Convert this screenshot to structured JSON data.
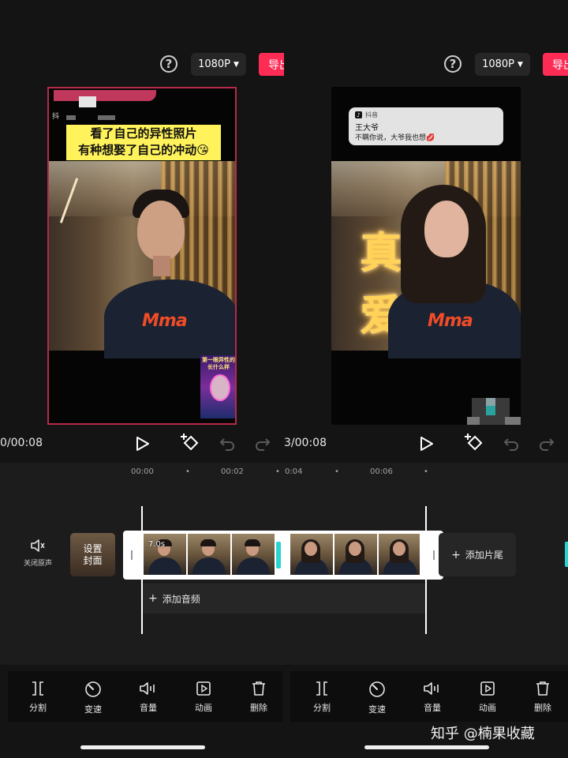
{
  "top_bar": {
    "help_symbol": "?",
    "resolution": "1080P",
    "export_label": "导出"
  },
  "left_preview": {
    "header_tag": "抖",
    "caption_line1": "看了自己的异性照片",
    "caption_line2": "有种想娶了自己的冲动",
    "caption_emoji": "😘",
    "shirt_text": "Mma",
    "sticker_text_1": "第一眼异性的",
    "sticker_text_2": "长什么样"
  },
  "right_preview": {
    "notif_app": "抖音",
    "notif_title": "王大爷",
    "notif_body": "不瞒你说，大爷我也想💋",
    "overlay_text": "真 爱",
    "shirt_text": "Mma"
  },
  "playback": {
    "left_time": "0/00:08",
    "right_time": "3/00:08"
  },
  "ruler": {
    "ticks": [
      "00:00",
      "•",
      "00:02",
      "•",
      "0:04",
      "•",
      "00:06",
      "•"
    ]
  },
  "track": {
    "mute_label": "关闭原声",
    "cover_label_1": "设置",
    "cover_label_2": "封面",
    "clip_duration": "7.0s",
    "add_ending": "添加片尾",
    "add_audio": "添加音频"
  },
  "toolbar": {
    "items": [
      {
        "label": "分割",
        "icon": "split-icon"
      },
      {
        "label": "变速",
        "icon": "speed-icon"
      },
      {
        "label": "音量",
        "icon": "volume-icon"
      },
      {
        "label": "动画",
        "icon": "animation-icon"
      },
      {
        "label": "删除",
        "icon": "delete-icon"
      }
    ]
  },
  "watermark": "知乎 @楠果收藏",
  "colors": {
    "accent": "#fe2c55",
    "background": "#141414",
    "caption_bg": "#fff25a",
    "clip_border": "#ffffff"
  }
}
